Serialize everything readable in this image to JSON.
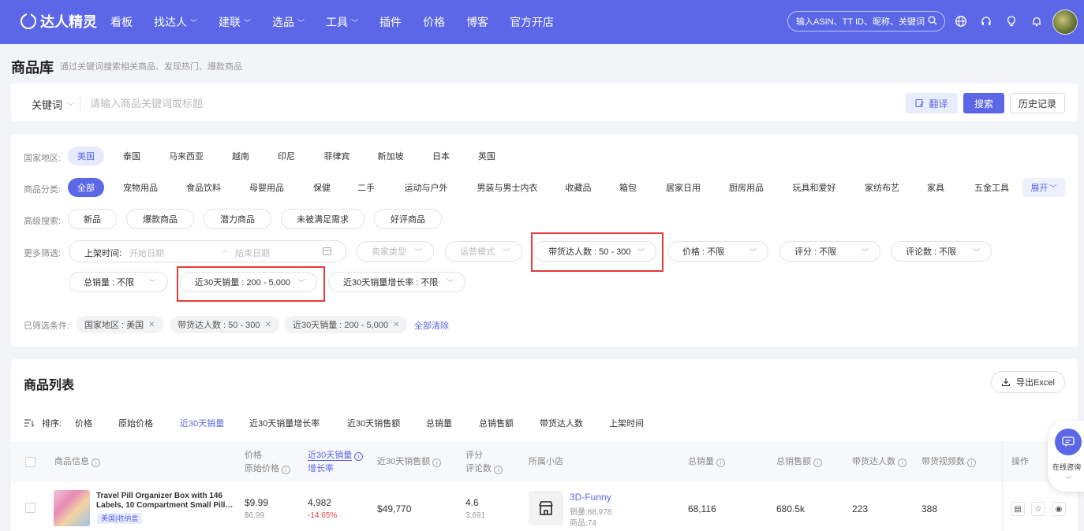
{
  "nav": {
    "logo": "达人精灵",
    "items": [
      {
        "label": "看板",
        "caret": false
      },
      {
        "label": "找达人",
        "caret": true
      },
      {
        "label": "建联",
        "caret": true
      },
      {
        "label": "选品",
        "caret": true
      },
      {
        "label": "工具",
        "caret": true
      },
      {
        "label": "插件",
        "caret": false
      },
      {
        "label": "价格",
        "caret": false
      },
      {
        "label": "博客",
        "caret": false
      },
      {
        "label": "官方开店",
        "caret": false
      }
    ],
    "search_placeholder": "输入ASIN、TT ID、昵称、关键词",
    "icons": [
      "globe-icon",
      "headset-icon",
      "bulb-icon",
      "bell-icon"
    ]
  },
  "page": {
    "title": "商品库",
    "subtitle": "通过关键词搜索相关商品、发现热门、爆款商品"
  },
  "keyword_bar": {
    "select_label": "关键词",
    "placeholder": "请输入商品关键词或标题",
    "translate_label": "翻译",
    "search_label": "搜索",
    "history_label": "历史记录"
  },
  "filters": {
    "region_label": "国家地区:",
    "regions": [
      "美国",
      "泰国",
      "马来西亚",
      "越南",
      "印尼",
      "菲律宾",
      "新加坡",
      "日本",
      "英国"
    ],
    "region_active": "美国",
    "category_label": "商品分类:",
    "categories": [
      "全部",
      "宠物用品",
      "食品饮料",
      "母婴用品",
      "保健",
      "二手",
      "运动与户外",
      "男装与男士内衣",
      "收藏品",
      "箱包",
      "居家日用",
      "厨房用品",
      "玩具和爱好",
      "家纺布艺",
      "家具",
      "五金工具"
    ],
    "expand_label": "展开",
    "advanced_label": "高级搜索:",
    "advanced": [
      "新品",
      "爆款商品",
      "潜力商品",
      "未被满足需求",
      "好评商品"
    ],
    "more_label": "更多筛选:",
    "date_label": "上架时间:",
    "date_start": "开始日期",
    "date_end": "结束日期",
    "seller_type": "卖家类型",
    "shipping_mode": "运营模式",
    "creator_count": "带货达人数 : 50 - 300",
    "price": "价格 : 不限",
    "rating": "评分 : 不限",
    "review_count": "评论数 : 不限",
    "total_sales": "总销量 : 不限",
    "sales_30d": "近30天销量 : 200 - 5,000",
    "growth_30d": "近30天销量增长率 : 不限",
    "applied_label": "已筛选条件:",
    "applied_tags": [
      "国家地区 : 美国",
      "带货达人数 : 50 - 300",
      "近30天销量 : 200 - 5,000"
    ],
    "clear_all": "全部清除"
  },
  "list": {
    "title": "商品列表",
    "export_label": "导出Excel",
    "sort_label": "排序:",
    "sort_items": [
      "价格",
      "原始价格",
      "近30天销量",
      "近30天销量增长率",
      "近30天销售额",
      "总销量",
      "总销售额",
      "带货达人数",
      "上架时间"
    ],
    "sort_active": "近30天销量",
    "headers": {
      "product": "商品信息",
      "price": "价格",
      "orig_price": "原始价格",
      "sales30": "近30天销量",
      "growth": "增长率",
      "revenue30": "近30天销售额",
      "rating": "评分",
      "reviews": "评论数",
      "shop": "所属小店",
      "total_sales": "总销量",
      "total_revenue": "总销售额",
      "creators": "带货达人数",
      "videos": "带货视频数",
      "ops": "操作"
    },
    "rows": [
      {
        "title": "Travel Pill Organizer Box with 146 Labels, 10 Compartment Small Pill…",
        "tag": "美国|收纳盒",
        "price": "$9.99",
        "orig_price": "$6.99",
        "sales30": "4,982",
        "growth": "-14.65%",
        "revenue30": "$49,770",
        "rating": "4.6",
        "reviews": "3,691",
        "shop_name": "3D-Funny",
        "shop_sales": "销量:88,978",
        "shop_products": "商品:74",
        "total_sales": "68,116",
        "total_revenue": "680.5k",
        "creators": "223",
        "videos": "388"
      }
    ]
  },
  "float": {
    "label": "在线咨询"
  }
}
